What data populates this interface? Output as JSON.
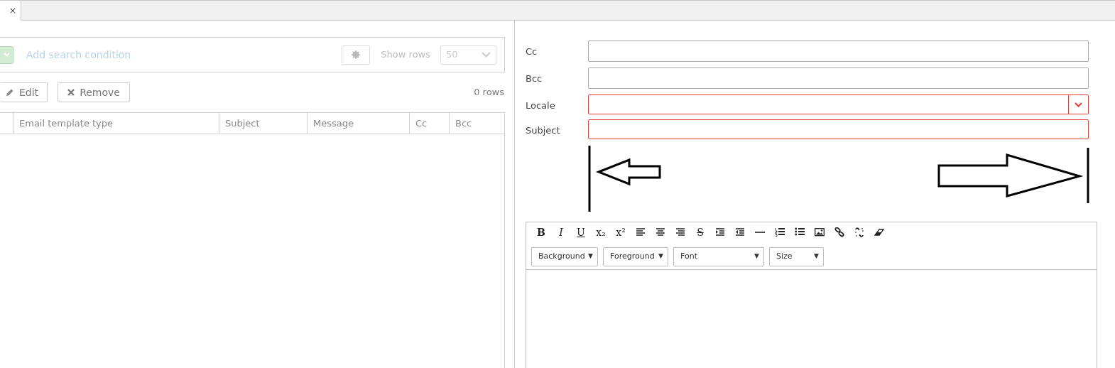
{
  "tab": {
    "close": "×",
    "selected": true
  },
  "search": {
    "add_condition": "Add search condition",
    "show_rows_label": "Show rows",
    "show_rows_value": "50",
    "disabled": true
  },
  "actions": [
    {
      "label": "Edit"
    },
    {
      "label": "Remove"
    }
  ],
  "row_count": "0 rows",
  "table": {
    "columns": [
      "",
      "Email template type",
      "Subject",
      "Message",
      "Cc",
      "Bcc"
    ]
  },
  "form": {
    "fields": [
      {
        "label": "Cc",
        "kind": "text",
        "invalid": false
      },
      {
        "label": "Bcc",
        "kind": "text",
        "invalid": false
      },
      {
        "label": "Locale",
        "kind": "select",
        "invalid": true
      },
      {
        "label": "Subject",
        "kind": "text",
        "invalid": true
      }
    ]
  },
  "editor": {
    "tools": [
      {
        "kind": "text",
        "label": "B"
      },
      {
        "kind": "text",
        "label": "I"
      },
      {
        "kind": "text",
        "label": "U"
      },
      {
        "kind": "text",
        "label": "x₂"
      },
      {
        "kind": "text",
        "label": "x²"
      },
      {
        "kind": "icon"
      },
      {
        "kind": "icon"
      },
      {
        "kind": "icon"
      },
      {
        "kind": "text",
        "label": "S"
      },
      {
        "kind": "icon"
      },
      {
        "kind": "icon"
      },
      {
        "kind": "icon"
      },
      {
        "kind": "icon"
      },
      {
        "kind": "icon"
      },
      {
        "kind": "icon"
      },
      {
        "kind": "icon"
      },
      {
        "kind": "icon"
      },
      {
        "kind": "icon"
      }
    ],
    "dropdowns": [
      {
        "label": "Background",
        "caret": "▼"
      },
      {
        "label": "Foreground",
        "caret": "▼"
      },
      {
        "label": "Font",
        "caret": "▼"
      },
      {
        "label": "Size",
        "caret": "▼"
      }
    ]
  }
}
